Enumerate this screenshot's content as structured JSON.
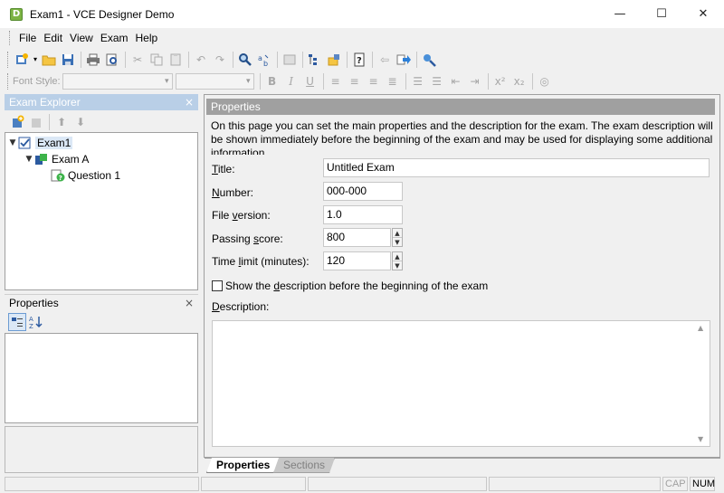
{
  "window": {
    "title": "Exam1 - VCE Designer Demo",
    "app_icon_letter": "D",
    "minimize": "—",
    "maximize": "☐",
    "close": "✕"
  },
  "menu": {
    "items": [
      "File",
      "Edit",
      "View",
      "Exam",
      "Help"
    ]
  },
  "toolbar2": {
    "font_style_label": "Font Style:"
  },
  "explorer": {
    "title": "Exam Explorer",
    "close": "×",
    "tree": [
      {
        "label": "Exam1",
        "toggle": "▼"
      },
      {
        "label": "Exam A",
        "toggle": "▼"
      },
      {
        "label": "Question 1",
        "toggle": ""
      }
    ]
  },
  "properties_panel": {
    "title": "Properties",
    "close": "×"
  },
  "main": {
    "header": "Properties",
    "intro": "On this page you can set the main properties and the description for the exam. The exam description will be shown immediately before the beginning of the exam and may be used for displaying some additional information.",
    "fields": {
      "title": {
        "label_ul": "T",
        "label_rest": "itle:",
        "value": "Untitled Exam"
      },
      "number": {
        "label_ul": "N",
        "label_rest": "umber:",
        "value": "000-000"
      },
      "file_version": {
        "label_pre": "File ",
        "label_ul": "v",
        "label_rest": "ersion:",
        "value": "1.0"
      },
      "passing_score": {
        "label_pre": "Passing ",
        "label_ul": "s",
        "label_rest": "core:",
        "value": "800"
      },
      "time_limit": {
        "label_pre": "Time ",
        "label_ul": "l",
        "label_rest": "imit (minutes):",
        "value": "120"
      }
    },
    "show_description": {
      "label_pre": "Show the ",
      "label_ul": "d",
      "label_rest": "escription before the beginning of the exam",
      "checked": false
    },
    "description": {
      "label_ul": "D",
      "label_rest": "escription:"
    },
    "tabs": [
      {
        "label": "Properties",
        "active": true
      },
      {
        "label": "Sections",
        "active": false
      }
    ]
  },
  "statusbar": {
    "cap": "CAP",
    "num": "NUM"
  }
}
